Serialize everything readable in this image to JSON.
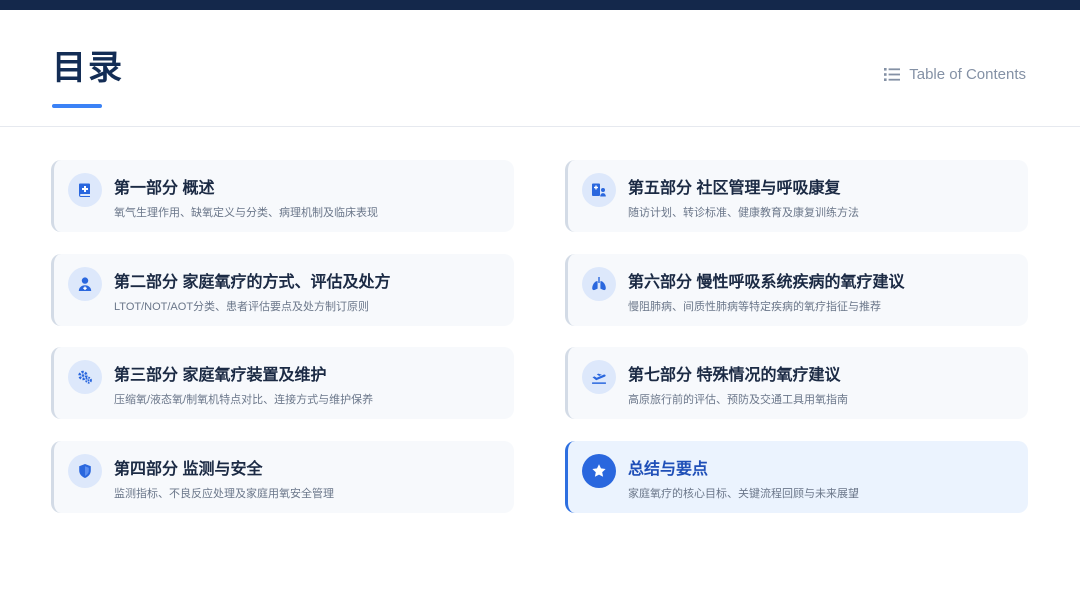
{
  "header": {
    "title": "目录",
    "toc_label": "Table of Contents"
  },
  "colors": {
    "top_bar": "#14284b",
    "title": "#132d55",
    "accent": "#3b82f6",
    "highlight_accent": "#2d6fe0",
    "card_bg": "#f7f9fc",
    "highlight_bg": "#ebf3fe"
  },
  "sections": [
    {
      "title": "第一部分 概述",
      "desc": "氧气生理作用、缺氧定义与分类、病理机制及临床表现",
      "icon": "book-medical-icon"
    },
    {
      "title": "第二部分 家庭氧疗的方式、评估及处方",
      "desc": "LTOT/NOT/AOT分类、患者评估要点及处方制订原则",
      "icon": "user-doctor-icon"
    },
    {
      "title": "第三部分 家庭氧疗装置及维护",
      "desc": "压缩氧/液态氧/制氧机特点对比、连接方式与维护保养",
      "icon": "gears-icon"
    },
    {
      "title": "第四部分 监测与安全",
      "desc": "监测指标、不良反应处理及家庭用氧安全管理",
      "icon": "shield-icon"
    },
    {
      "title": "第五部分 社区管理与呼吸康复",
      "desc": "随访计划、转诊标准、健康教育及康复训练方法",
      "icon": "hospital-user-icon"
    },
    {
      "title": "第六部分 慢性呼吸系统疾病的氧疗建议",
      "desc": "慢阻肺病、间质性肺病等特定疾病的氧疗指征与推荐",
      "icon": "lungs-icon"
    },
    {
      "title": "第七部分 特殊情况的氧疗建议",
      "desc": "高原旅行前的评估、预防及交通工具用氧指南",
      "icon": "plane-departure-icon"
    },
    {
      "title": "总结与要点",
      "desc": "家庭氧疗的核心目标、关键流程回顾与未来展望",
      "icon": "star-icon"
    }
  ]
}
